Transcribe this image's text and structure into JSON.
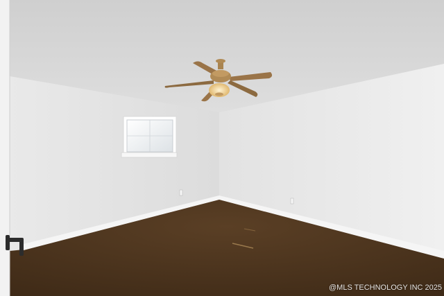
{
  "photo": {
    "subject": "Empty room with ceiling fan, window and carpet",
    "watermark": "@MLS TECHNOLOGY INC 2025",
    "colors": {
      "ceiling": "#d6d6d6",
      "left_wall": "#e6e6e6",
      "right_wall": "#ececec",
      "carpet": "#4a3420",
      "baseboard": "#f4f4f4",
      "fan_blade": "#9a7448",
      "fan_brass": "#b08a55",
      "light_glow": "#f3d9a1"
    }
  }
}
